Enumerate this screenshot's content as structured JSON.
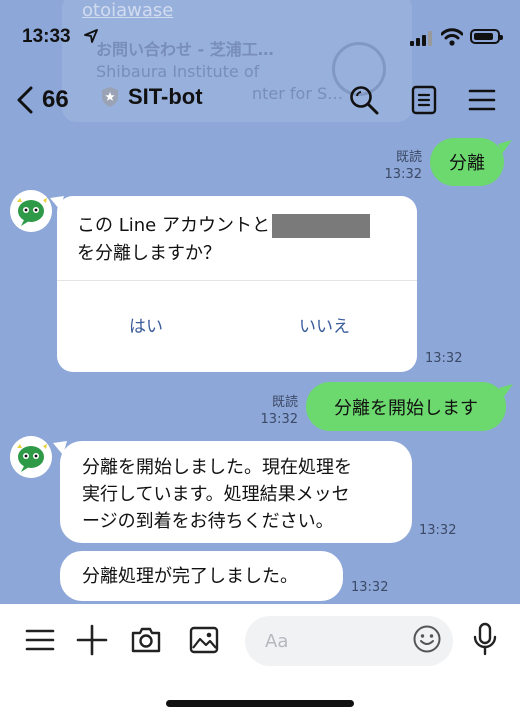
{
  "status_bar": {
    "time": "13:33"
  },
  "preview": {
    "url": "otoiawase",
    "title": "お問い合わせ - 芝浦工…",
    "line2": "Shibaura Institute of",
    "line3": "nter for S…"
  },
  "header": {
    "back_count": "66",
    "title": "SIT-bot"
  },
  "messages": {
    "m1": {
      "text": "分離",
      "read": "既読",
      "time": "13:32"
    },
    "card": {
      "question_prefix": "この Line アカウントと",
      "question_suffix": "を分離しますか？",
      "yes": "はい",
      "no": "いいえ",
      "time": "13:32"
    },
    "m2": {
      "text": "分離を開始します",
      "read": "既読",
      "time": "13:32"
    },
    "m3": {
      "line1": "分離を開始しました。現在処理を",
      "line2": "実行しています。処理結果メッセ",
      "line3": "ージの到着をお待ちください。",
      "time": "13:32"
    },
    "m4": {
      "text": "分離処理が完了しました。",
      "time": "13:32"
    }
  },
  "input": {
    "placeholder": "Aa"
  },
  "colors": {
    "chat_bg": "#8da7d8",
    "outgoing_bubble": "#6cd96e",
    "link": "#3b5c9c"
  }
}
